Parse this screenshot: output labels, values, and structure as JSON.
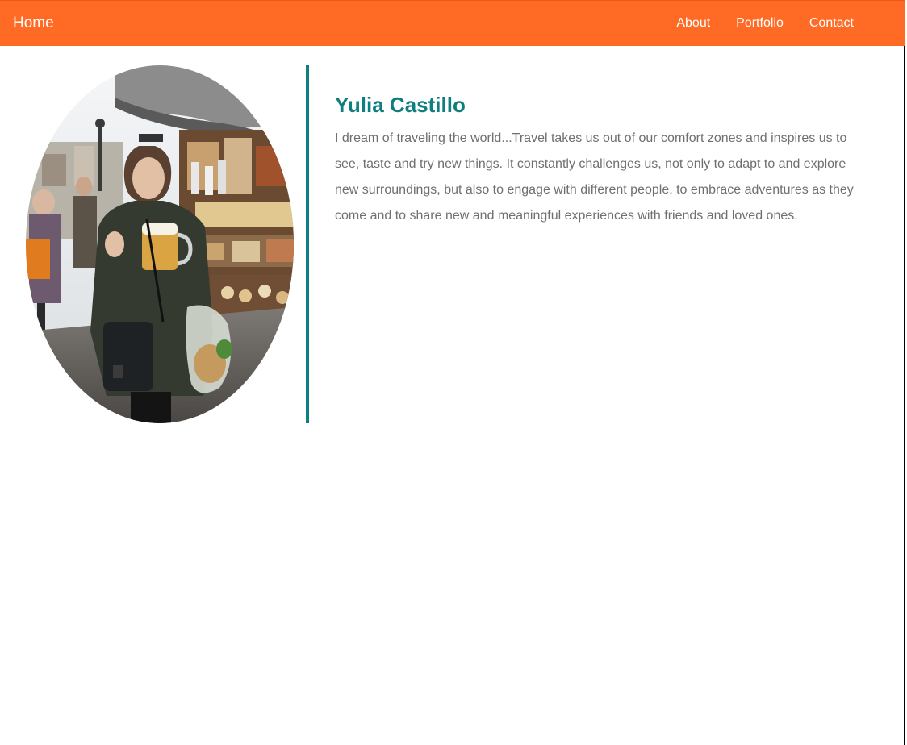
{
  "navbar": {
    "brand": "Home",
    "links": [
      "About",
      "Portfolio",
      "Contact"
    ]
  },
  "profile": {
    "name": "Yulia Castillo",
    "bio": "I dream of traveling the world...Travel takes us out of our comfort zones and inspires us to see, taste and try new things. It constantly challenges us, not only to adapt to and explore new surroundings, but also to engage with different people, to embrace adventures as they come and to share new and meaningful experiences with friends and loved ones."
  },
  "colors": {
    "navbar": "#ff6a24",
    "accent": "#0f7e7e",
    "body_text": "#6f6f6f"
  }
}
